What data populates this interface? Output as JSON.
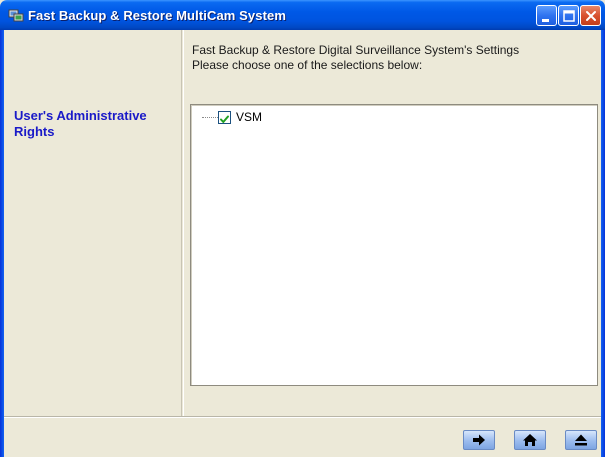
{
  "window": {
    "title": "Fast Backup & Restore MultiCam System",
    "controls": [
      "minimize-icon",
      "maximize-icon",
      "close-icon"
    ]
  },
  "sidebar": {
    "label": "User's Administrative Rights"
  },
  "content": {
    "header_line1": "Fast Backup & Restore Digital Surveillance System's Settings",
    "header_line2": "Please choose one of the selections below:"
  },
  "tree": {
    "items": [
      {
        "label": "VSM",
        "checked": true
      }
    ]
  },
  "footer": {
    "buttons": [
      "next-arrow-icon",
      "home-icon",
      "eject-icon"
    ]
  },
  "colors": {
    "titlebar": "#0054df",
    "sidebar_label": "#1a1ac8",
    "window_bg": "#ece9d8"
  }
}
